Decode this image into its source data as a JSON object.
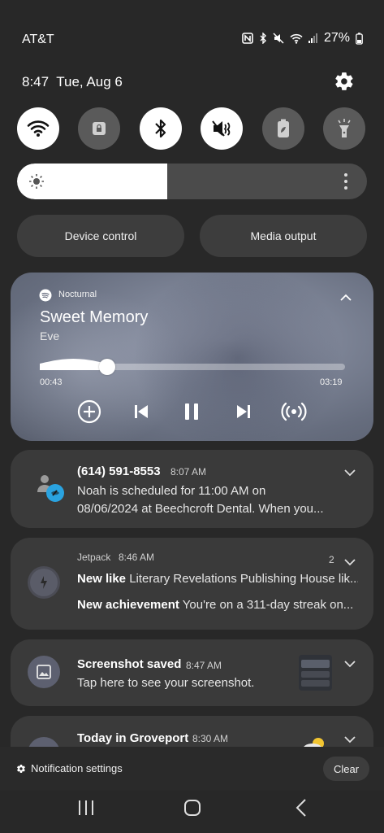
{
  "status_bar": {
    "carrier": "AT&T",
    "battery": "27%"
  },
  "header": {
    "time": "8:47",
    "date": "Tue, Aug 6"
  },
  "quick_settings": {
    "tiles": [
      {
        "icon": "wifi-icon",
        "state": "on"
      },
      {
        "icon": "lock-icon",
        "state": "off"
      },
      {
        "icon": "bluetooth-icon",
        "state": "on"
      },
      {
        "icon": "mute-icon",
        "state": "on"
      },
      {
        "icon": "power-saving-icon",
        "state": "off"
      },
      {
        "icon": "flashlight-icon",
        "state": "off"
      }
    ],
    "brightness_fraction": 0.43,
    "device_control_label": "Device control",
    "media_output_label": "Media output"
  },
  "media": {
    "app": "Nocturnal",
    "title": "Sweet Memory",
    "artist": "Eve",
    "elapsed": "00:43",
    "duration": "03:19",
    "progress_fraction": 0.22
  },
  "notifications": [
    {
      "title": "(614) 591-8553",
      "time": "8:07 AM",
      "body_line1": "Noah is scheduled for 11:00 AM on",
      "body_line2": "08/06/2024 at Beechcroft Dental. When you..."
    },
    {
      "app": "Jetpack",
      "time": "8:46 AM",
      "count": "2",
      "items": [
        {
          "label": "New like",
          "text": "Literary Revelations Publishing House lik..."
        },
        {
          "label": "New achievement",
          "text": "You're on a 311-day streak on..."
        }
      ]
    },
    {
      "title": "Screenshot saved",
      "time": "8:47 AM",
      "body": "Tap here to see your screenshot."
    },
    {
      "title": "Today in Groveport",
      "time": "8:30 AM"
    }
  ],
  "footer": {
    "settings_label": "Notification settings",
    "clear_label": "Clear"
  },
  "colors": {
    "tile_on": "#ffffff",
    "tile_off": "#5a5a5a",
    "background": "#282828",
    "card": "#3a3a3a",
    "badge_blue": "#2aa3e0"
  }
}
